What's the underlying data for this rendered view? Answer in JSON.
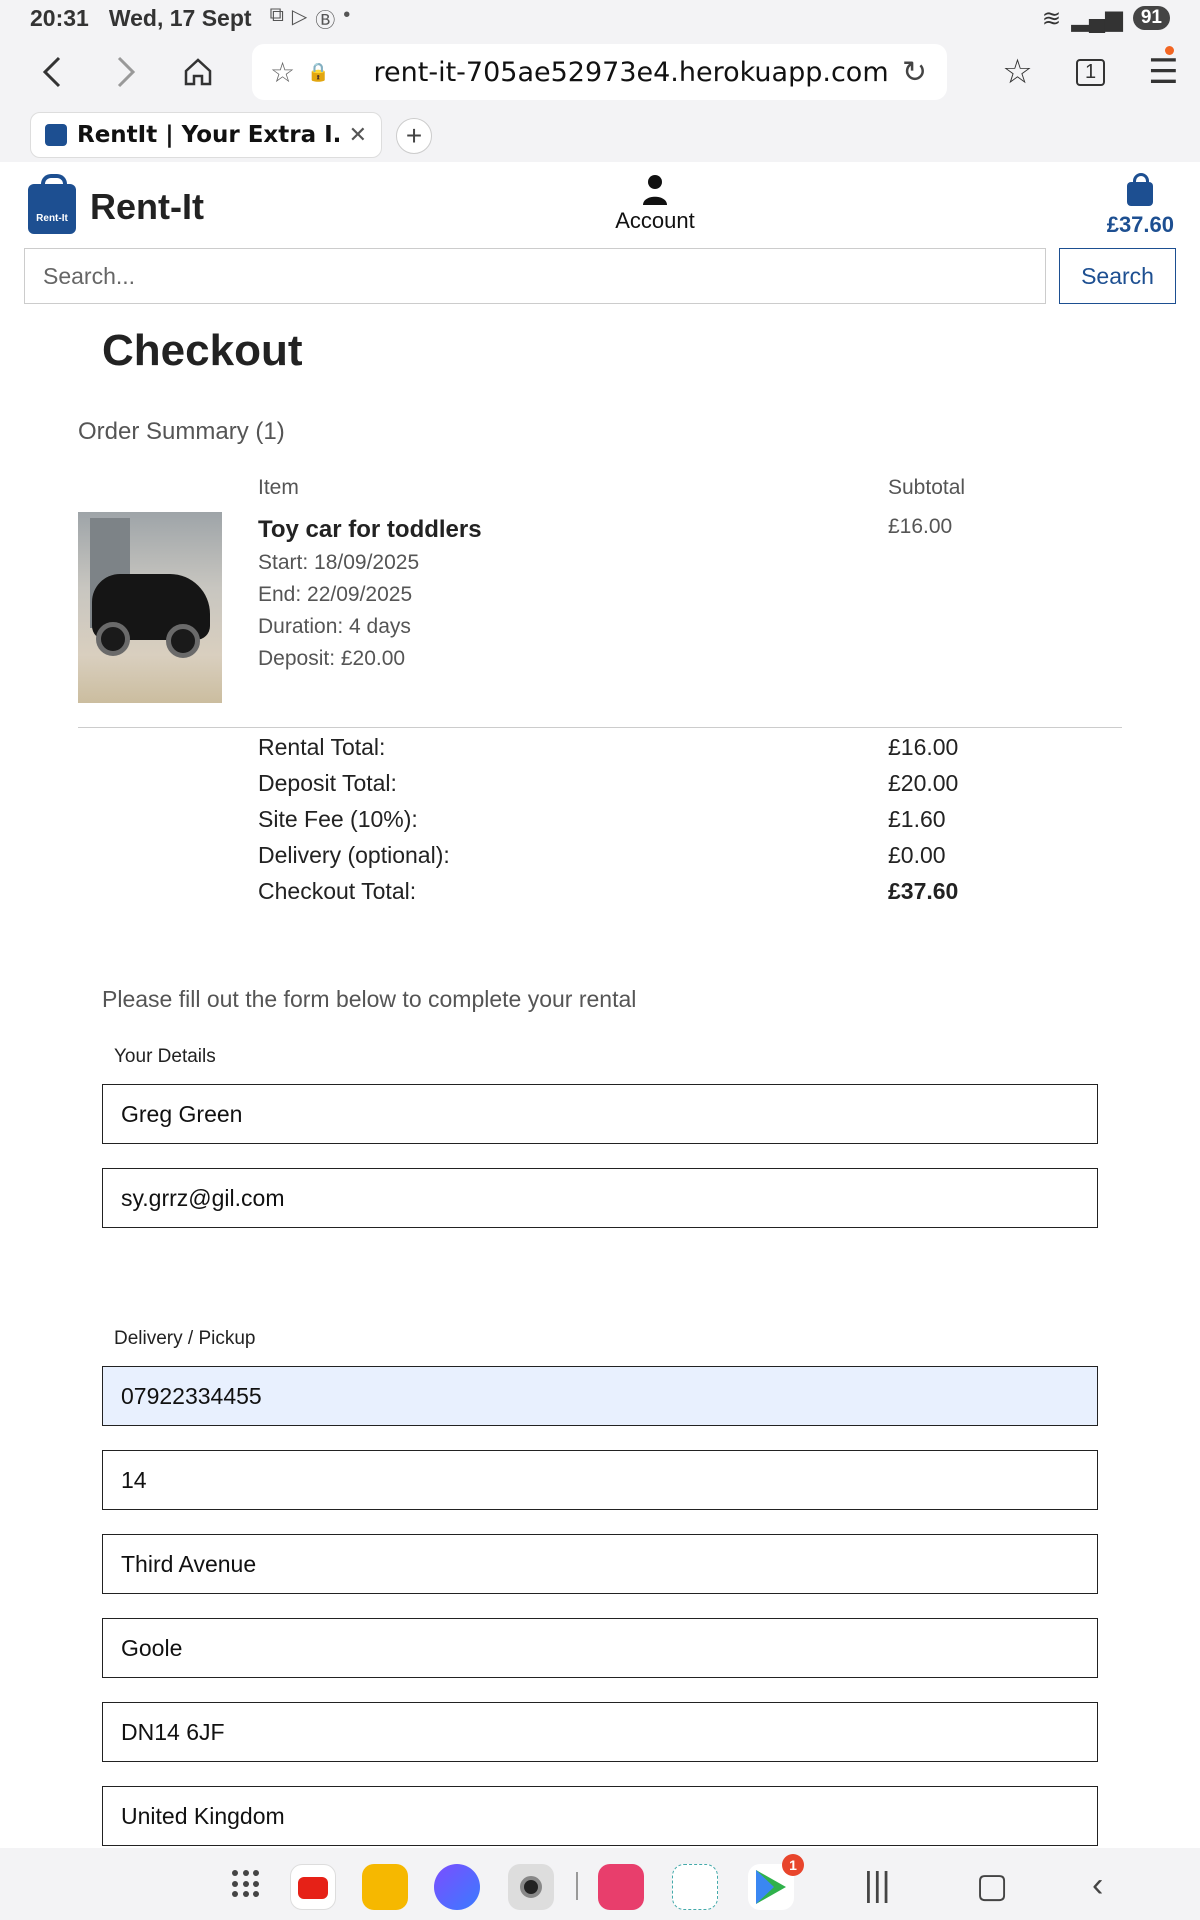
{
  "status_bar": {
    "time": "20:31",
    "date": "Wed, 17 Sept",
    "battery": "91"
  },
  "browser": {
    "url": "rent-it-705ae52973e4.herokuapp.com",
    "tab_title": "RentIt | Your Extra I...",
    "tab_count": "1"
  },
  "header": {
    "logo_badge": "Rent-It",
    "brand": "Rent-It",
    "account_label": "Account",
    "cart_total": "£37.60"
  },
  "search": {
    "placeholder": "Search...",
    "button_label": "Search"
  },
  "checkout": {
    "title": "Checkout",
    "order_summary": "Order Summary (1)",
    "col_item": "Item",
    "col_subtotal": "Subtotal",
    "item": {
      "name": "Toy car for toddlers",
      "start": "Start: 18/09/2025",
      "end": "End: 22/09/2025",
      "duration": "Duration: 4 days",
      "deposit": "Deposit: £20.00",
      "subtotal": "£16.00"
    },
    "totals": [
      {
        "label": "Rental Total:",
        "value": "£16.00"
      },
      {
        "label": "Deposit Total:",
        "value": "£20.00"
      },
      {
        "label": "Site Fee (10%):",
        "value": "£1.60"
      },
      {
        "label": "Delivery (optional):",
        "value": "£0.00"
      },
      {
        "label": "Checkout Total:",
        "value": "£37.60"
      }
    ]
  },
  "form": {
    "intro": "Please fill out the form below to complete your rental",
    "your_details_label": "Your Details",
    "full_name": "Greg Green",
    "email": "sy.grrz@gil.com",
    "delivery_label": "Delivery / Pickup",
    "phone": "07922334455",
    "street1": "14",
    "street2": "Third Avenue",
    "town": "Goole",
    "postcode": "DN14 6JF",
    "country": "United Kingdom"
  },
  "nav_badge": "1",
  "colors": {
    "brand_blue": "#1d4f91",
    "autofill_bg": "#e8f0fe"
  }
}
